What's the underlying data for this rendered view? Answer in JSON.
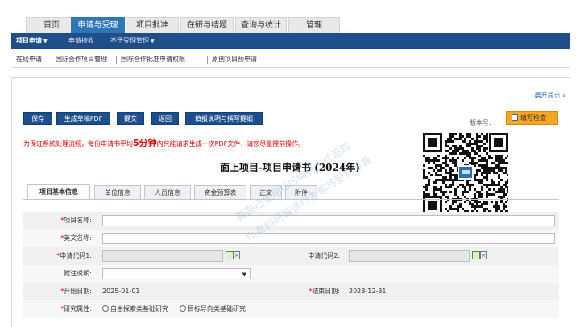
{
  "top_tabs": [
    "首页",
    "申请与受理",
    "项目批准",
    "在研与结题",
    "查询与统计",
    "管理"
  ],
  "nav": {
    "project_apply": "项目申请",
    "apply_receive": "申请接收",
    "not_accept": "不予受理管理"
  },
  "sub_nav": [
    "在线申请",
    "国际合作项目管理",
    "国际合作批准申请权限",
    "原创项目预申请"
  ],
  "expand_tip": "展开提示",
  "buttons": {
    "save": "保存",
    "gen_pdf": "生成草稿PDF",
    "submit": "提交",
    "back": "返回",
    "fill_guide": "填报说明与撰写提纲",
    "check": "填写检查"
  },
  "version_label": "版本号:",
  "warning": {
    "pre": "为保证系统处理流畅，每份申请书平均",
    "big": "5分钟",
    "post": "内只能请求生成一次PDF文件，请您尽量提前操作。"
  },
  "form_title": "面上项目-项目申请书 (2024年)",
  "form_tabs": [
    "项目基本信息",
    "单位信息",
    "人员信息",
    "资金预算表",
    "正文",
    "附件"
  ],
  "fields": {
    "project_name": "项目名称:",
    "english_name": "英文名称:",
    "apply_code1": "申请代码1:",
    "apply_code2": "申请代码2:",
    "note": "附注说明:",
    "start_date_label": "开始日期:",
    "start_date": "2025-01-01",
    "end_date_label": "结束日期:",
    "end_date": "2028-12-31",
    "research_attr": "研究属性:",
    "option1": "自由探索类基础研究",
    "option2": "目标导向类基础研究"
  },
  "watermark": [
    "截图已使用ISIS编码方式追踪",
    "所有科研诚信行为都将受到监督"
  ],
  "colors": {
    "nav": "#1f4e8a",
    "tab_active": "#2f76b6",
    "button": "#1d4f8e",
    "check": "#f5a623",
    "warning": "#e00000"
  }
}
